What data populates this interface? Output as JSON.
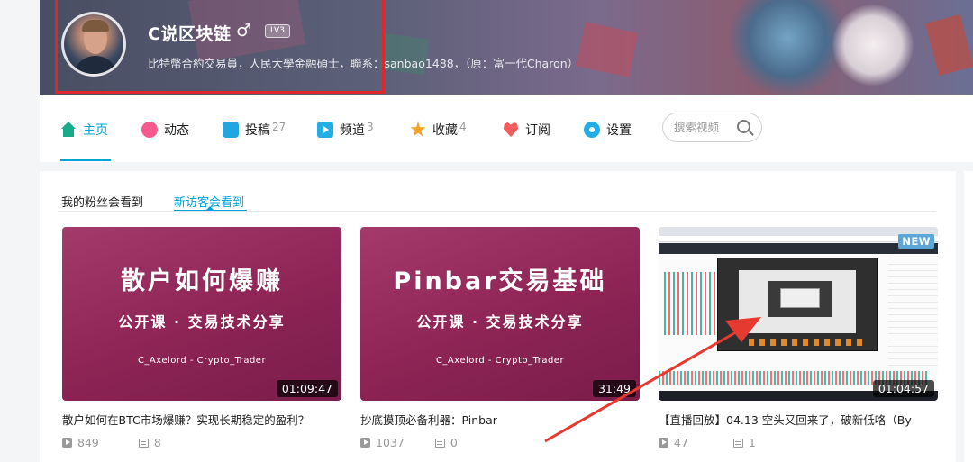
{
  "profile": {
    "username": "C说区块链",
    "gender_icon": "♂",
    "level": "LV3",
    "bio": "比特幣合約交易員，人民大學金融碩士，聯系：sanbao1488，（原：富一代Charon）"
  },
  "nav": {
    "items": [
      {
        "label": "主页",
        "icon": "home-icon",
        "count": ""
      },
      {
        "label": "动态",
        "icon": "dynamic-icon",
        "count": ""
      },
      {
        "label": "投稿",
        "icon": "upload-icon",
        "count": "27"
      },
      {
        "label": "频道",
        "icon": "channel-icon",
        "count": "3"
      },
      {
        "label": "收藏",
        "icon": "favorite-icon",
        "count": "4"
      },
      {
        "label": "订阅",
        "icon": "subscribe-icon",
        "count": ""
      },
      {
        "label": "设置",
        "icon": "settings-icon",
        "count": ""
      }
    ],
    "active_index": 0,
    "search_placeholder": "搜索视频",
    "accent_color": "#00a1d6"
  },
  "sub_tabs": [
    {
      "label": "我的粉丝会看到",
      "active": false
    },
    {
      "label": "新访客会看到",
      "active": true
    }
  ],
  "videos": [
    {
      "thumb_title": "散户如何爆赚",
      "thumb_subtitle": "公开课 · 交易技术分享",
      "thumb_author": "C_Axelord - Crypto_Trader",
      "duration": "01:09:47",
      "title": "散户如何在BTC市场爆赚？实现长期稳定的盈利？",
      "plays": "849",
      "danmaku": "8"
    },
    {
      "thumb_title": "Pinbar交易基础",
      "thumb_subtitle": "公开课 · 交易技术分享",
      "thumb_author": "C_Axelord - Crypto_Trader",
      "duration": "31:49",
      "title": "抄底摸顶必备利器：Pinbar",
      "plays": "1037",
      "danmaku": "0"
    },
    {
      "badge": "NEW",
      "duration": "01:04:57",
      "title": "【直播回放】04.13 空头又回来了，破新低咯（By",
      "plays": "47",
      "danmaku": "1"
    }
  ],
  "annotation_colors": {
    "box": "#e1262d",
    "arrow": "#e53a2f"
  }
}
